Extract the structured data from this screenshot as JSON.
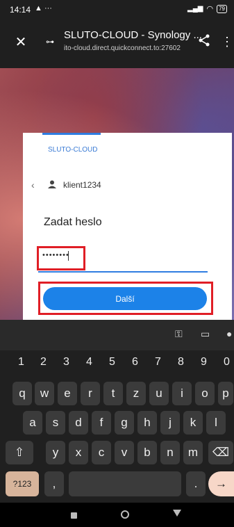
{
  "status_bar": {
    "time": "14:14",
    "battery": "79"
  },
  "browser": {
    "title": "SLUTO-CLOUD - Synology ...",
    "url": "ito-cloud.direct.quickconnect.to:27602",
    "icons": [
      "close-icon",
      "site-settings-icon",
      "share-icon",
      "more-vert-icon"
    ]
  },
  "login": {
    "brand": "SLUTO-CLOUD",
    "username": "klient1234",
    "heading": "Zadat heslo",
    "password_dots": "••••••••",
    "next_label": "Další"
  },
  "keyboard": {
    "numbers": [
      "1",
      "2",
      "3",
      "4",
      "5",
      "6",
      "7",
      "8",
      "9",
      "0"
    ],
    "row1": [
      "q",
      "w",
      "e",
      "r",
      "t",
      "z",
      "u",
      "i",
      "o",
      "p"
    ],
    "row2": [
      "a",
      "s",
      "d",
      "f",
      "g",
      "h",
      "j",
      "k",
      "l"
    ],
    "row3": [
      "y",
      "x",
      "c",
      "v",
      "b",
      "n",
      "m"
    ],
    "symbols_label": "?123",
    "comma": ",",
    "period": "."
  },
  "colors": {
    "accent": "#1c82e8",
    "highlight": "#e01e26"
  }
}
